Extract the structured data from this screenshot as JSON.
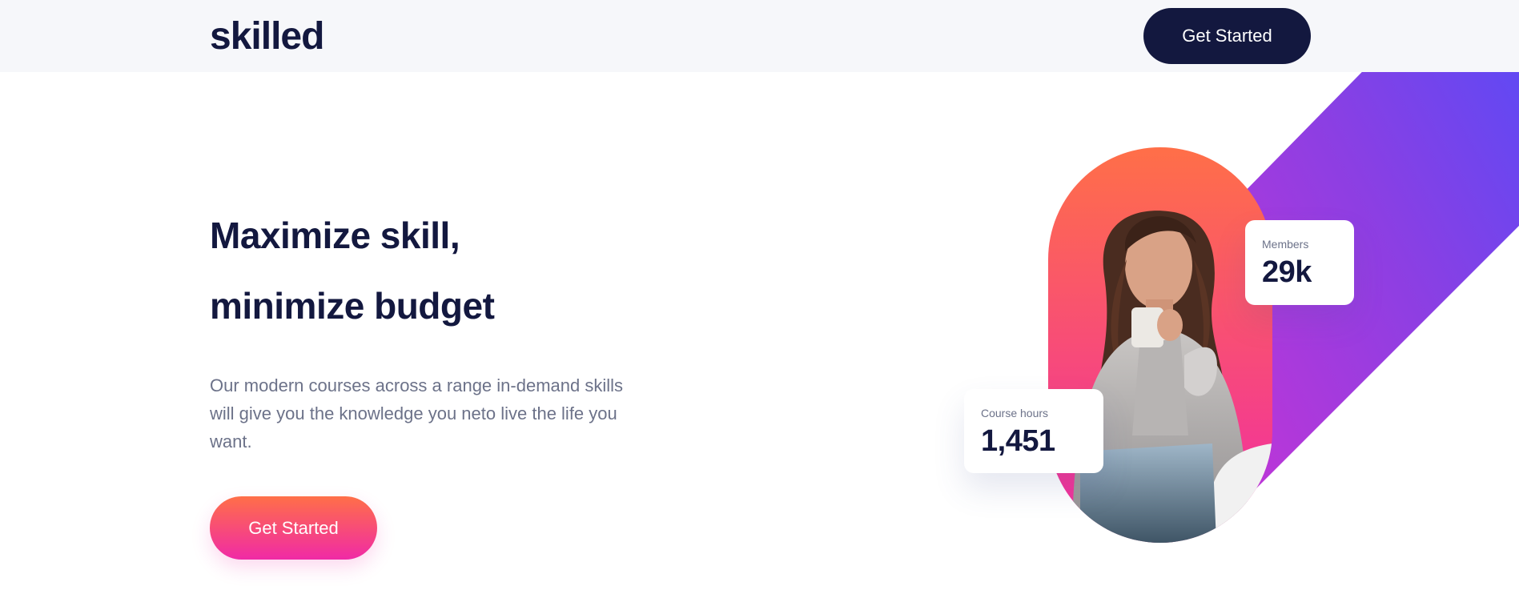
{
  "header": {
    "logo": "skilled",
    "cta_label": "Get Started"
  },
  "hero": {
    "title_line1": "Maximize skill,",
    "title_line2": "minimize budget",
    "description": "Our modern courses across a range in-demand skills will give you the knowledge you neto live the life you want.",
    "cta_label": "Get Started"
  },
  "stats": {
    "members": {
      "label": "Members",
      "value": "29k"
    },
    "course_hours": {
      "label": "Course hours",
      "value": "1,451"
    }
  },
  "colors": {
    "navy": "#13183f",
    "gradient_orange": "#ff6f48",
    "gradient_pink": "#f02aa6",
    "stripe_purple": "#9b3de8",
    "stripe_blue": "#5a4af6",
    "body_text": "#6c7289",
    "header_bg": "#f6f7fa"
  },
  "illustration": {
    "photo_subject": "person-drinking-coffee-with-laptop",
    "decor": "diagonal-gradient-stripe"
  }
}
